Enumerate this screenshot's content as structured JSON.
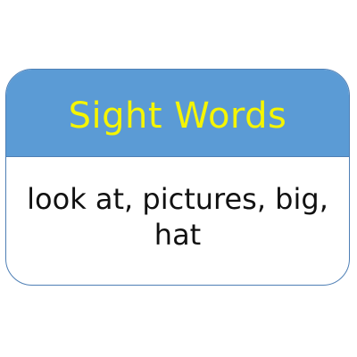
{
  "card": {
    "title": "Sight Words",
    "words": "look at, pictures, big, hat"
  },
  "colors": {
    "header_background": "#5b9bd5",
    "title_text": "#f5f500",
    "border": "#4e7fb5",
    "body_text": "#111111"
  }
}
